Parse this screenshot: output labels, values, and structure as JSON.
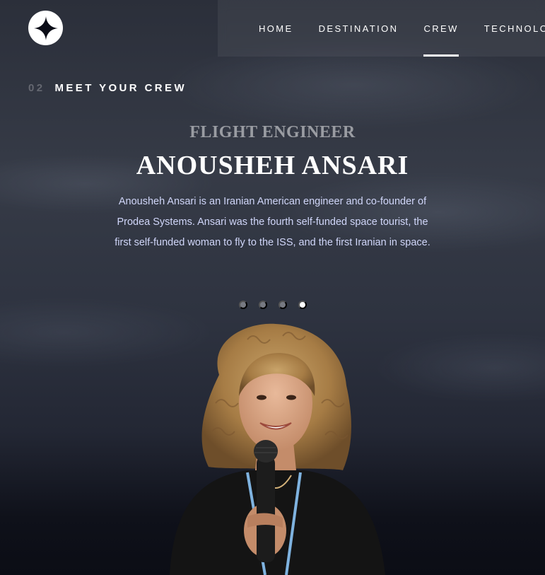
{
  "header": {
    "logo_icon": "star-icon",
    "nav": [
      {
        "num": "",
        "label": "HOME"
      },
      {
        "num": "",
        "label": "DESTINATION"
      },
      {
        "num": "",
        "label": "CREW"
      },
      {
        "num": "",
        "label": "TECHNOLOGY"
      }
    ],
    "active_nav": "CREW"
  },
  "section": {
    "number": "02",
    "title": "MEET YOUR CREW"
  },
  "crew": {
    "role": "FLIGHT ENGINEER",
    "name": "ANOUSHEH ANSARI",
    "bio": "Anousheh Ansari is an Iranian American engineer and co-founder of Prodea Systems. Ansari was the fourth self-funded space tourist, the first self-funded woman to fly to the ISS, and the first Iranian in space.",
    "slides_total": 4,
    "active_slide": 4
  },
  "colors": {
    "background": "#0b0d17",
    "text_light": "#d0d6f9",
    "white": "#ffffff"
  }
}
